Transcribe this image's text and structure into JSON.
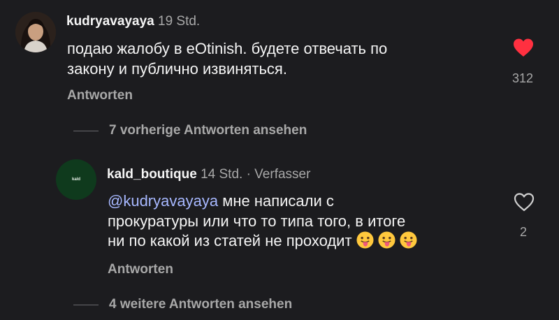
{
  "comment": {
    "username": "kudryavayaya",
    "timestamp": "19 Std.",
    "text_lines": [
      "подаю жалобу в eOtinish. будете отвечать по",
      "закону и публично извиняться."
    ],
    "reply_label": "Antworten",
    "likes": "312",
    "liked": true,
    "like_icon": "heart-filled-icon"
  },
  "previous_replies_label": "7 vorherige Antworten ansehen",
  "reply": {
    "avatar_text": "kald",
    "username": "kald_boutique",
    "timestamp": "14 Std.",
    "author_tag": "· Verfasser",
    "mention": "@kudryavayaya",
    "text_line1_rest": " мне написали с",
    "text_line2": "прокуратуры или что то типа того, в итоге",
    "text_line3": "ни по какой из статей не проходит",
    "emoji_icon": "tongue-out-emoji-icon",
    "emoji_count": 3,
    "reply_label": "Antworten",
    "likes": "2",
    "liked": false,
    "like_icon": "heart-outline-icon"
  },
  "more_replies_label": "4 weitere Antworten ansehen",
  "colors": {
    "background": "#1c1c1f",
    "text": "#f5f5f5",
    "secondary_text": "#a8a8a8",
    "mention": "#a7b8ff",
    "heart": "#ff3040",
    "shop_avatar": "#0f3a1d"
  }
}
